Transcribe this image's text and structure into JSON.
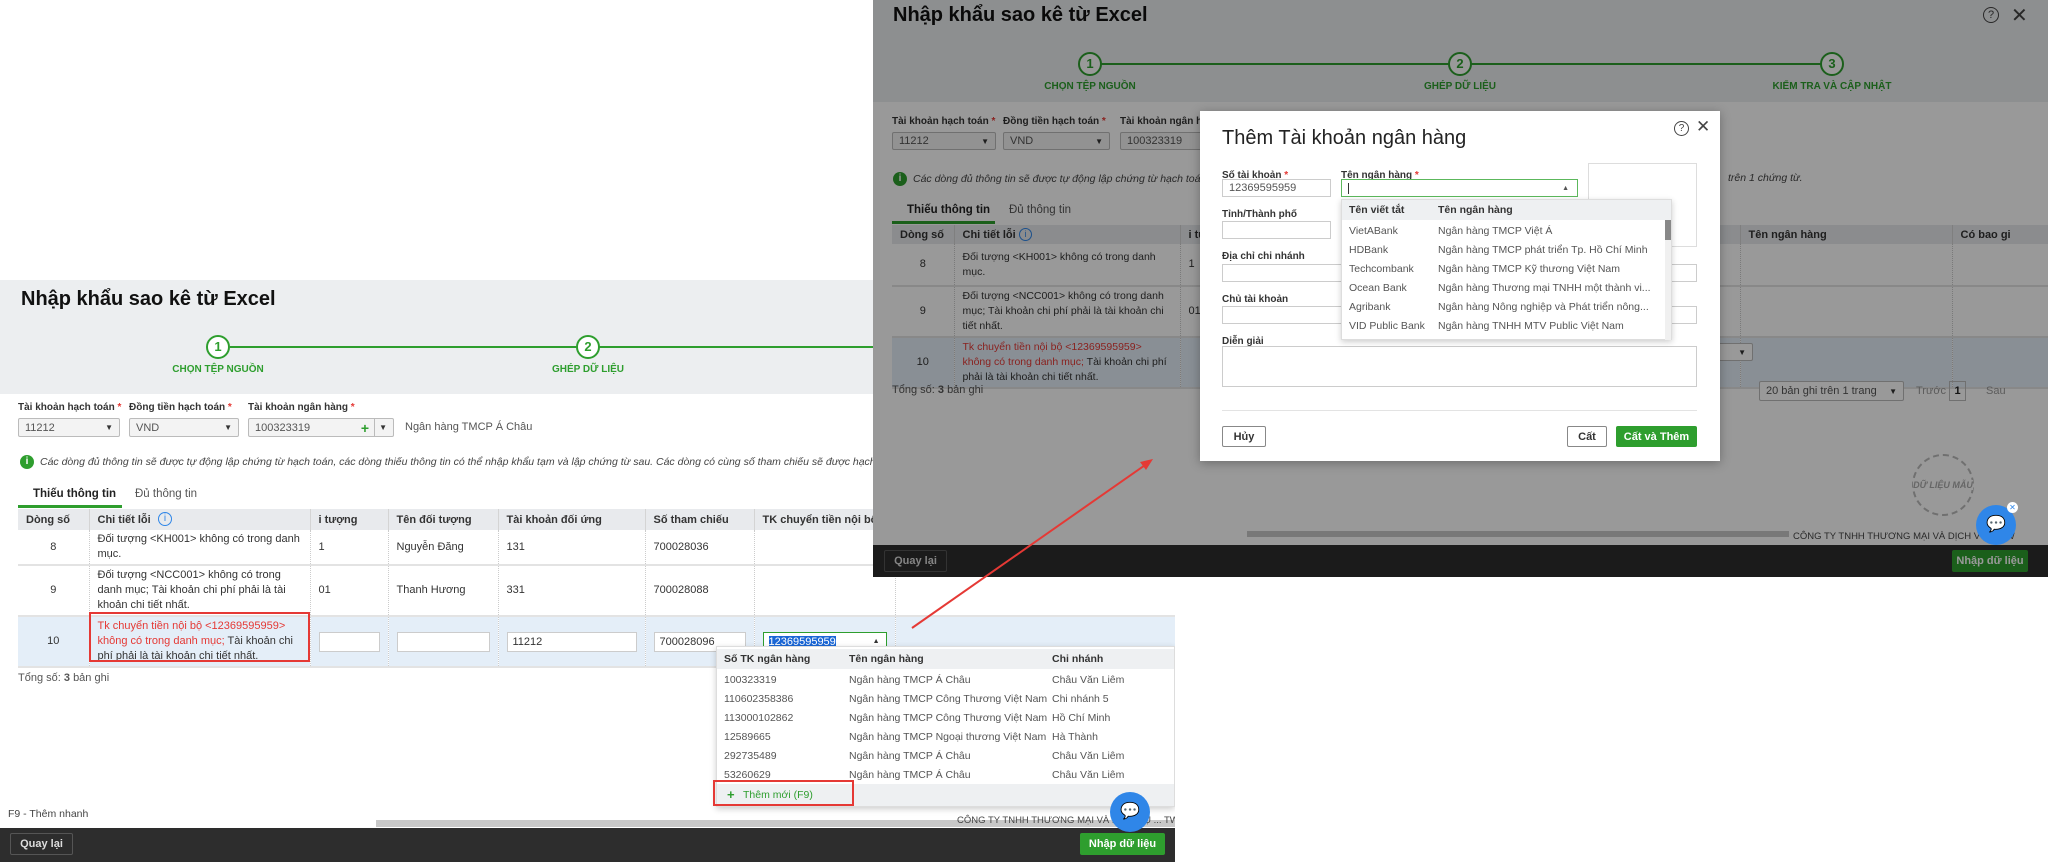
{
  "left": {
    "title": "Nhập khẩu sao kê từ Excel",
    "steps": [
      {
        "num": "1",
        "label": "CHỌN TỆP NGUỒN"
      },
      {
        "num": "2",
        "label": "GHÉP DỮ LIỆU"
      }
    ],
    "fields": {
      "account_label": "Tài khoản hạch toán",
      "account_value": "11212",
      "currency_label": "Đồng tiền hạch toán",
      "currency_value": "VND",
      "bank_account_label": "Tài khoản ngân hàng",
      "bank_account_value": "100323319",
      "bank_name": "Ngân hàng TMCP Á Châu",
      "required_mark": "*"
    },
    "info": "Các dòng đủ thông tin sẽ được tự động lập chứng từ hạch toán, các dòng thiếu thông tin có thể nhập khẩu tạm và lập chứng từ sau. Các dòng có cùng số tham chiếu sẽ được hạch toán chung trên",
    "tabs": [
      {
        "label": "Thiếu thông tin",
        "active": true
      },
      {
        "label": "Đủ thông tin",
        "active": false
      }
    ],
    "table": {
      "columns": [
        "Dòng số",
        "Chi tiết lỗi",
        "i tượng",
        "Tên đối tượng",
        "Tài khoản đối ứng",
        "Số tham chiếu",
        "TK chuyển tiền nội bộ",
        ""
      ],
      "rows": [
        {
          "line": "8",
          "error_red": "",
          "error": "Đối tượng <KH001> không có trong danh mục.",
          "obj": "1",
          "obj_name": "Nguyễn Đăng",
          "counter_account": "131",
          "ref": "700028036",
          "internal": ""
        },
        {
          "line": "9",
          "error_red": "",
          "error": "Đối tượng <NCC001> không có trong danh mục; Tài khoản chi phí phải là tài khoản chi tiết nhất.",
          "obj": "01",
          "obj_name": "Thanh Hương",
          "counter_account": "331",
          "ref": "700028088",
          "internal": ""
        },
        {
          "line": "10",
          "error_red": "Tk chuyển tiền nội bộ <12369595959> không có trong danh mục;",
          "error": " Tài khoản chi phí phải là tài khoản chi tiết nhất.",
          "obj": "",
          "obj_name": "",
          "counter_account": "11212",
          "ref": "700028096",
          "internal": "12369595959",
          "editing": true
        }
      ]
    },
    "total_label": "Tổng số:",
    "total_count": "3",
    "total_unit": "bản ghi",
    "dropdown": {
      "columns": [
        "Số TK ngân hàng",
        "Tên ngân hàng",
        "Chi nhánh"
      ],
      "rows": [
        [
          "100323319",
          "Ngân hàng TMCP Á Châu",
          "Châu Văn Liêm"
        ],
        [
          "110602358386",
          "Ngân hàng TMCP Công Thương Việt Nam",
          "Chi nhánh 5"
        ],
        [
          "113000102862",
          "Ngân hàng TMCP Công Thương Việt Nam",
          "Hồ Chí Minh"
        ],
        [
          "12589665",
          "Ngân hàng TMCP Ngoại thương Việt Nam",
          "Hà Thành"
        ],
        [
          "292735489",
          "Ngân hàng TMCP Á Châu",
          "Châu Văn Liêm"
        ],
        [
          "53260629",
          "Ngân hàng TMCP Á Châu",
          "Châu Văn Liêm"
        ]
      ],
      "add_new": "Thêm mới (F9)"
    },
    "shortcut_hint": "F9 - Thêm nhanh",
    "company": "CÔNG TY TNHH THƯƠNG MẠI VÀ DỊCH VỤ ... TW",
    "back": "Quay lại",
    "import": "Nhập dữ liệu"
  },
  "right": {
    "title": "Nhập khẩu sao kê từ Excel",
    "steps": [
      {
        "num": "1",
        "label": "CHỌN TỆP NGUỒN"
      },
      {
        "num": "2",
        "label": "GHÉP DỮ LIỆU"
      },
      {
        "num": "3",
        "label": "KIỂM TRA VÀ CẬP NHẬT"
      }
    ],
    "fields": {
      "account_label": "Tài khoản hạch toán",
      "account_value": "11212",
      "currency_label": "Đồng tiền hạch toán",
      "currency_value": "VND",
      "bank_account_label": "Tài khoản ngân hà",
      "bank_account_value": "100323319"
    },
    "info": "Các dòng đủ thông tin sẽ được tự động lập chứng từ hạch toán, các",
    "info_tail": "trên 1 chứng từ.",
    "tabs": [
      {
        "label": "Thiếu thông tin"
      },
      {
        "label": "Đủ thông tin"
      }
    ],
    "table": {
      "columns": [
        "Dòng số",
        "Chi tiết lỗi",
        "i tu",
        "",
        "",
        "bộ",
        "Tên ngân hàng",
        "Có bao gi"
      ],
      "rows": [
        {
          "line": "8",
          "error_red": "",
          "error": "Đối tượng <KH001> không có trong danh mục.",
          "obj": "1"
        },
        {
          "line": "9",
          "error_red": "",
          "error": "Đối tượng <NCC001> không có trong danh mục; Tài khoản chi phí phải là tài khoản chi tiết nhất.",
          "obj": "01"
        },
        {
          "line": "10",
          "error_red": "Tk chuyển tiền nội bộ <12369595959> không có trong danh mục;",
          "error": " Tài khoản chi phí phải là tài khoản chi tiết nhất.",
          "obj": ""
        }
      ]
    },
    "total_label": "Tổng số:",
    "total_count": "3",
    "total_unit": "bản ghi",
    "page_size": "20 bản ghi trên 1 trang",
    "prev": "Trước",
    "page": "1",
    "next": "Sau",
    "stamp": "DỮ LIỆU MẪU",
    "company": "CÔNG TY TNHH THƯƠNG MẠI VÀ DỊCH VỤ ... TW",
    "back": "Quay lại",
    "import": "Nhập dữ liệu",
    "modal": {
      "title": "Thêm Tài khoản ngân hàng",
      "account_no_label": "Số tài khoản",
      "account_no_value": "12369595959",
      "bank_name_label": "Tên ngân hàng",
      "bank_name_value": "",
      "city_label": "Tỉnh/Thành phố",
      "branch_address_label": "Địa chỉ chi nhánh",
      "owner_label": "Chủ tài khoản",
      "description_label": "Diễn giải",
      "required_mark": "*",
      "cancel": "Hủy",
      "save": "Cất",
      "save_add": "Cất và Thêm",
      "bank_list": {
        "columns": [
          "Tên viết tắt",
          "Tên ngân hàng"
        ],
        "rows": [
          [
            "VietABank",
            "Ngân hàng TMCP Việt Á"
          ],
          [
            "HDBank",
            "Ngân hàng TMCP phát triển Tp. Hồ Chí Minh"
          ],
          [
            "Techcombank",
            "Ngân hàng TMCP Kỹ thương Việt Nam"
          ],
          [
            "Ocean Bank",
            "Ngân hàng Thương mại TNHH một thành vi..."
          ],
          [
            "Agribank",
            "Ngân hàng Nông nghiệp và Phát triển nông..."
          ],
          [
            "VID Public Bank",
            "Ngân hàng TNHH MTV Public Việt Nam"
          ]
        ]
      }
    }
  },
  "colors": {
    "accent": "#2e9e2e",
    "error": "#e53935",
    "annotation": "#e53935",
    "chat": "#2f86e8",
    "footer": "#2d2d2d"
  }
}
